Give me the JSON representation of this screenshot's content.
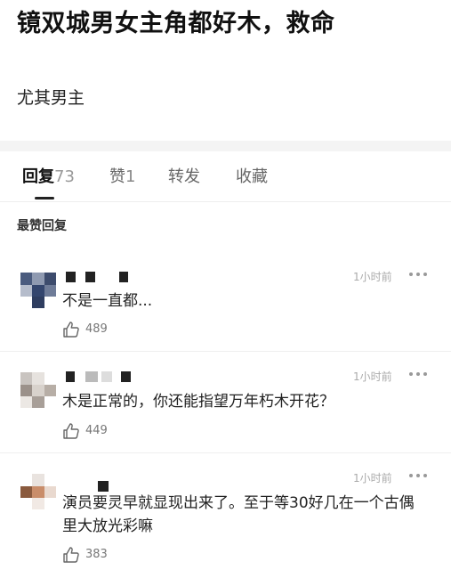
{
  "post": {
    "title": "镜双城男女主角都好木，救命",
    "body": "尤其男主"
  },
  "tabs": [
    {
      "label": "回复",
      "count": "73",
      "active": true
    },
    {
      "label": "赞",
      "count": "1",
      "active": false
    },
    {
      "label": "转发",
      "count": "",
      "active": false
    },
    {
      "label": "收藏",
      "count": "",
      "active": false
    }
  ],
  "sort_label": "最赞回复",
  "comments": [
    {
      "time": "1小时前",
      "text": "不是一直都...",
      "likes": "489"
    },
    {
      "time": "1小时前",
      "text": "木是正常的，你还能指望万年朽木开花？",
      "likes": "449"
    },
    {
      "time": "1小时前",
      "text": "演员要灵早就显现出来了。至于等30好几在一个古偶里大放光彩嘛",
      "likes": "383"
    }
  ],
  "icons": {
    "more": "more-dots-icon",
    "like": "thumbs-up-icon"
  },
  "colors": {
    "text_primary": "#111111",
    "text_secondary": "#777777",
    "muted": "#aaaaaa",
    "divider": "#f4f4f4"
  }
}
